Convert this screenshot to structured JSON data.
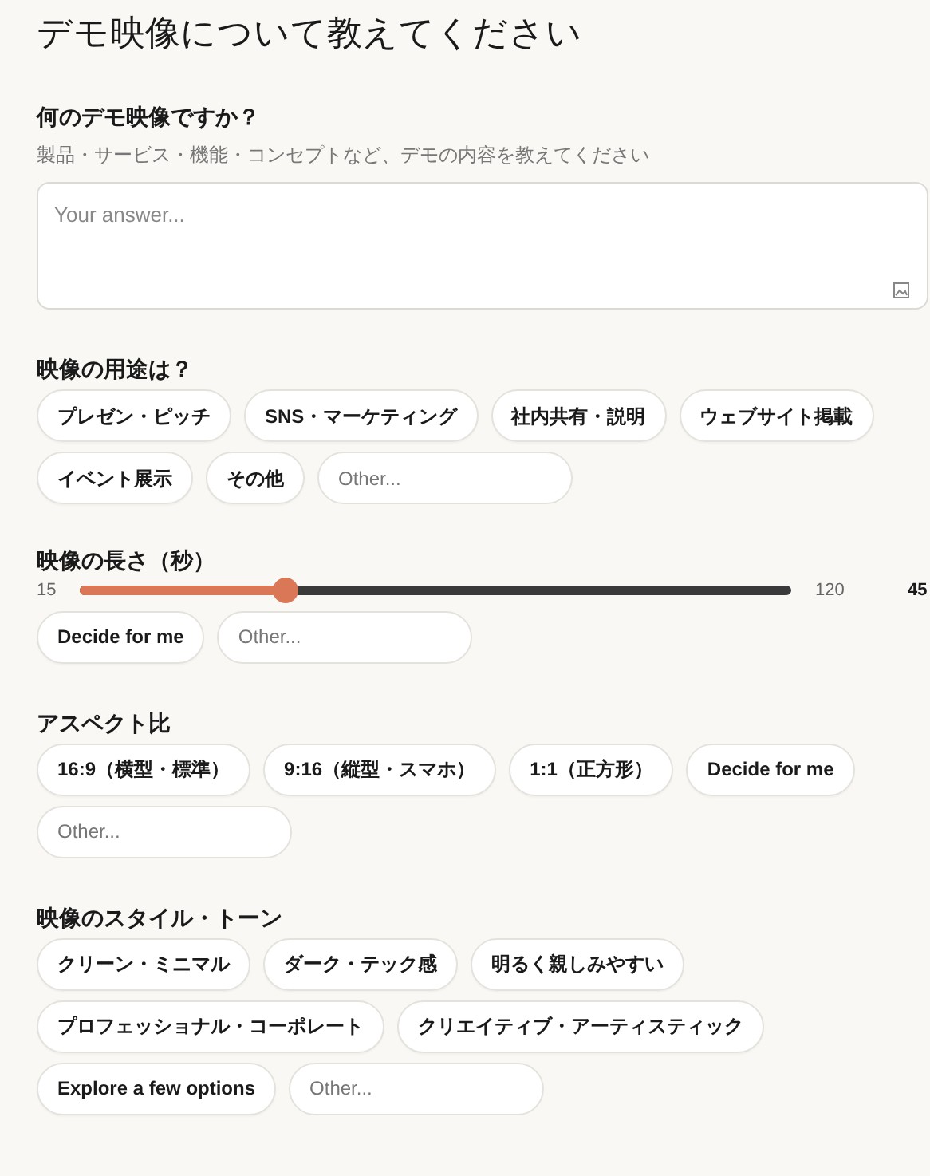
{
  "title": "デモ映像について教えてください",
  "sections": [
    {
      "kind": "text",
      "label": "何のデモ映像ですか？",
      "hint": "製品・サービス・機能・コンセプトなど、デモの内容を教えてください",
      "placeholder": "Your answer..."
    },
    {
      "kind": "chips",
      "label": "映像の用途は？",
      "options": [
        "プレゼン・ピッチ",
        "SNS・マーケティング",
        "社内共有・説明",
        "ウェブサイト掲載",
        "イベント展示",
        "その他"
      ],
      "other": {
        "placeholder": "Other..."
      }
    },
    {
      "kind": "slider",
      "label": "映像の長さ（秒）",
      "min": "15",
      "max": "120",
      "value": "45",
      "level": 0.29,
      "options": [
        "Decide for me"
      ],
      "other": {
        "placeholder": "Other..."
      }
    },
    {
      "kind": "chips",
      "label": "アスペクト比",
      "options": [
        "16:9（横型・標準）",
        "9:16（縦型・スマホ）",
        "1:1（正方形）",
        "Decide for me"
      ],
      "other": {
        "placeholder": "Other..."
      }
    },
    {
      "kind": "chips",
      "label": "映像のスタイル・トーン",
      "options": [
        "クリーン・ミニマル",
        "ダーク・テック感",
        "明るく親しみやすい",
        "プロフェッショナル・コーポレート",
        "クリエイティブ・アーティスティック",
        "Explore a few options"
      ],
      "other": {
        "placeholder": "Other..."
      }
    }
  ]
}
